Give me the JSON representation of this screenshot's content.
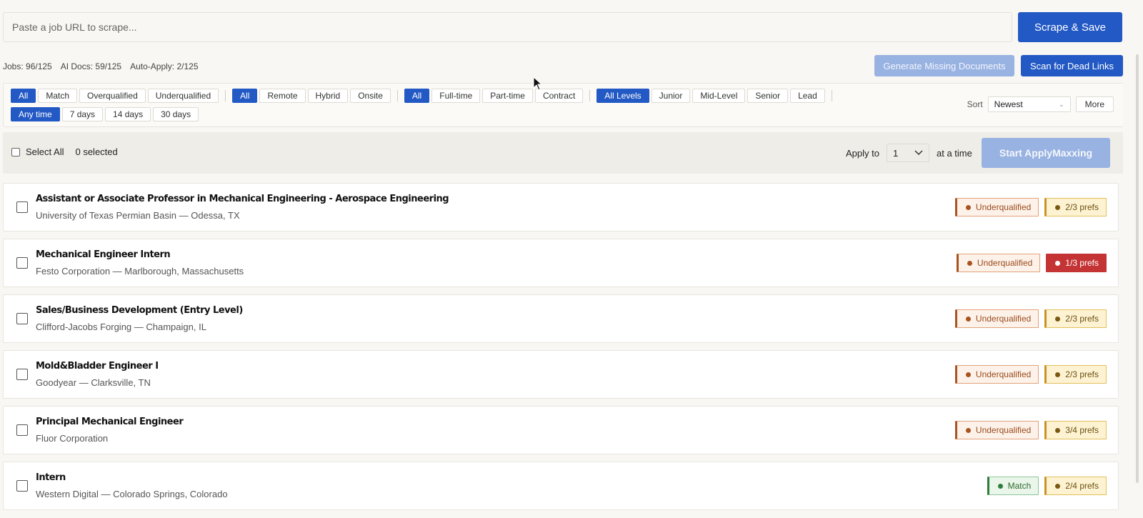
{
  "url_bar": {
    "placeholder": "Paste a job URL to scrape...",
    "scrape_label": "Scrape & Save"
  },
  "stats": {
    "jobs": "Jobs: 96/125",
    "ai_docs": "AI Docs: 59/125",
    "auto_apply": "Auto-Apply: 2/125"
  },
  "actions": {
    "generate_label": "Generate Missing Documents",
    "scan_label": "Scan for Dead Links"
  },
  "filters": {
    "match": [
      "All",
      "Match",
      "Overqualified",
      "Underqualified"
    ],
    "location": [
      "All",
      "Remote",
      "Hybrid",
      "Onsite"
    ],
    "type": [
      "All",
      "Full-time",
      "Part-time",
      "Contract"
    ],
    "level": [
      "All Levels",
      "Junior",
      "Mid-Level",
      "Senior",
      "Lead"
    ],
    "time": [
      "Any time",
      "7 days",
      "14 days",
      "30 days"
    ]
  },
  "sort": {
    "label": "Sort",
    "value": "Newest",
    "more_label": "More"
  },
  "bulk": {
    "select_all_label": "Select All",
    "selected_count": "0 selected",
    "apply_to_label": "Apply to",
    "apply_count": "1",
    "at_a_time_label": "at a time",
    "start_label": "Start ApplyMaxxing"
  },
  "jobs": [
    {
      "title": "Assistant or Associate Professor in Mechanical Engineering - Aerospace Engineering",
      "subtitle": "University of Texas Permian Basin — Odessa, TX",
      "match": "Underqualified",
      "prefs": "2/3 prefs"
    },
    {
      "title": "Mechanical Engineer Intern",
      "subtitle": "Festo Corporation — Marlborough, Massachusetts",
      "match": "Underqualified",
      "prefs": "1/3 prefs"
    },
    {
      "title": "Sales/Business Development (Entry Level)",
      "subtitle": "Clifford-Jacobs Forging — Champaign, IL",
      "match": "Underqualified",
      "prefs": "2/3 prefs"
    },
    {
      "title": "Mold&Bladder Engineer I",
      "subtitle": "Goodyear — Clarksville, TN",
      "match": "Underqualified",
      "prefs": "2/3 prefs"
    },
    {
      "title": "Principal Mechanical Engineer",
      "subtitle": "Fluor Corporation",
      "match": "Underqualified",
      "prefs": "3/4 prefs"
    },
    {
      "title": "Intern",
      "subtitle": "Western Digital — Colorado Springs, Colorado",
      "match": "Match",
      "prefs": "2/4 prefs"
    }
  ],
  "colors": {
    "primary": "#2359c4",
    "primary_disabled": "#98b2e2",
    "underqualified": "#a9531f",
    "prefs": "#c99224",
    "prefs_low": "#c53435",
    "match": "#2e7d3a"
  }
}
